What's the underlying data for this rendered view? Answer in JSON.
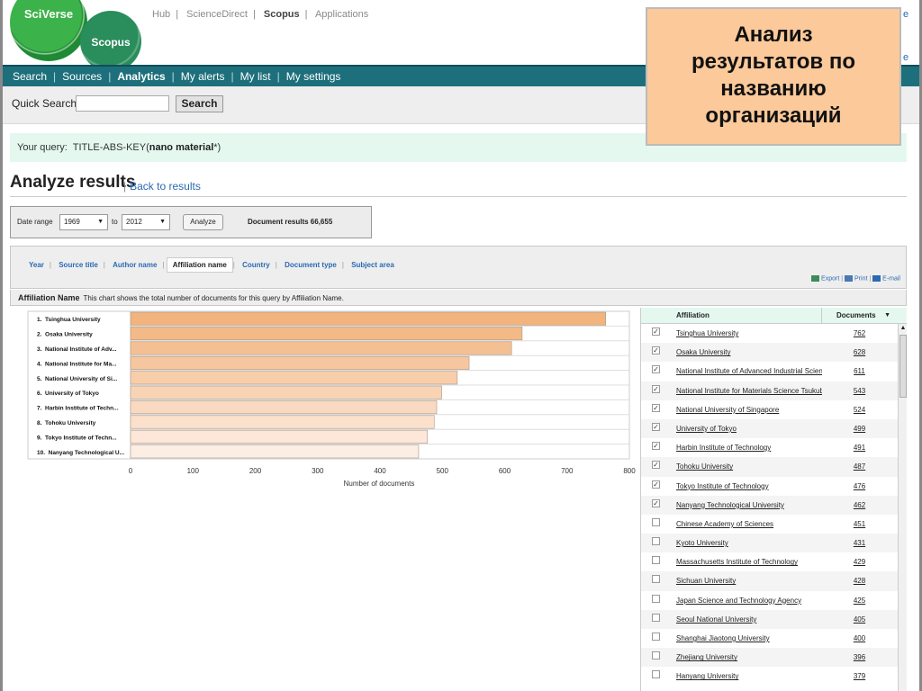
{
  "header": {
    "logo_main": "SciVerse",
    "logo_sub": "Scopus",
    "top_links": [
      "Hub",
      "ScienceDirect",
      "Scopus",
      "Applications"
    ],
    "active_top_link": "Scopus",
    "edge_right_1": "e",
    "edge_right_2": "e"
  },
  "main_nav": {
    "items": [
      "Search",
      "Sources",
      "Analytics",
      "My alerts",
      "My list",
      "My settings"
    ],
    "active": "Analytics"
  },
  "quick_search": {
    "label": "Quick Search",
    "input_value": "",
    "button_label": "Search"
  },
  "query": {
    "prefix": "Your query:",
    "field": "TITLE-ABS-KEY(",
    "term": "nano material",
    "suffix": "*)"
  },
  "page": {
    "title": "Analyze results",
    "separator": "|",
    "back_link": "Back to results"
  },
  "date_range": {
    "label": "Date range",
    "from": "1969",
    "to_label": "to",
    "to": "2012",
    "button": "Analyze",
    "document_results": "Document results 66,655"
  },
  "tabs": {
    "items": [
      "Year",
      "Source title",
      "Author name",
      "Affiliation name",
      "Country",
      "Document type",
      "Subject area"
    ],
    "active": "Affiliation name"
  },
  "export": {
    "export_label": "Export",
    "print_label": "Print",
    "email_label": "E-mail",
    "separator": "|"
  },
  "affiliation_header": {
    "title": "Affiliation Name",
    "description": "This chart shows the total number of documents for this query by Affiliation Name."
  },
  "chart_data": {
    "type": "bar",
    "orientation": "horizontal",
    "categories": [
      "1.  Tsinghua University",
      "2.  Osaka University",
      "3.  National Institute of Adv...",
      "4.  National Institute for Ma...",
      "5.  National University of Si...",
      "6.  University of Tokyo",
      "7.  Harbin Institute of Techn...",
      "8.  Tohoku University",
      "9.  Tokyo Institute of Techn...",
      "10.  Nanyang Technological U..."
    ],
    "values": [
      762,
      628,
      611,
      543,
      524,
      499,
      491,
      487,
      476,
      462
    ],
    "xlabel": "Number of documents",
    "xlim": [
      0,
      800
    ],
    "ticks": [
      0,
      100,
      200,
      300,
      400,
      500,
      600,
      700,
      800
    ],
    "bar_color_start": "#f2b37c",
    "bar_color_end": "#fdeee3",
    "grid": true
  },
  "table": {
    "col_affiliation": "Affiliation",
    "col_documents": "Documents",
    "rows": [
      {
        "name": "Tsinghua University",
        "count": "762",
        "checked": true
      },
      {
        "name": "Osaka University",
        "count": "628",
        "checked": true
      },
      {
        "name": "National Institute of Advanced Industrial Science",
        "count": "611",
        "checked": true
      },
      {
        "name": "National Institute for Materials Science Tsukuba",
        "count": "543",
        "checked": true
      },
      {
        "name": "National University of Singapore",
        "count": "524",
        "checked": true
      },
      {
        "name": "University of Tokyo",
        "count": "499",
        "checked": true
      },
      {
        "name": "Harbin Institute of Technology",
        "count": "491",
        "checked": true
      },
      {
        "name": "Tohoku University",
        "count": "487",
        "checked": true
      },
      {
        "name": "Tokyo Institute of Technology",
        "count": "476",
        "checked": true
      },
      {
        "name": "Nanyang Technological University",
        "count": "462",
        "checked": true
      },
      {
        "name": "Chinese Academy of Sciences",
        "count": "451",
        "checked": false
      },
      {
        "name": "Kyoto University",
        "count": "431",
        "checked": false
      },
      {
        "name": "Massachusetts Institute of Technology",
        "count": "429",
        "checked": false
      },
      {
        "name": "Sichuan University",
        "count": "428",
        "checked": false
      },
      {
        "name": "Japan Science and Technology Agency",
        "count": "425",
        "checked": false
      },
      {
        "name": "Seoul National University",
        "count": "405",
        "checked": false
      },
      {
        "name": "Shanghai Jiaotong University",
        "count": "400",
        "checked": false
      },
      {
        "name": "Zhejiang University",
        "count": "396",
        "checked": false
      },
      {
        "name": "Hanyang University",
        "count": "379",
        "checked": false
      }
    ]
  },
  "overlay_note": {
    "lines": [
      "Анализ",
      "результатов по",
      "названию",
      "организаций"
    ]
  }
}
